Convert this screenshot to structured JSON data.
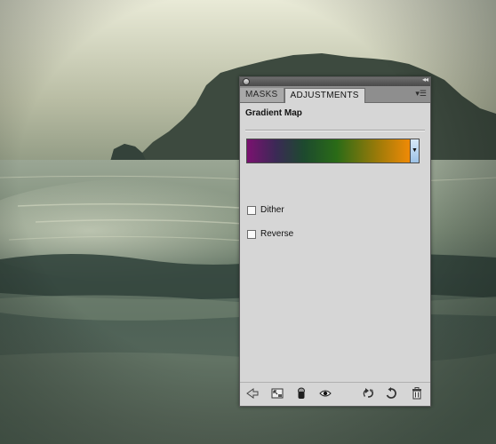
{
  "panel": {
    "tabs": [
      {
        "label": "MASKS",
        "active": false
      },
      {
        "label": "ADJUSTMENTS",
        "active": true
      }
    ],
    "adjustment_title": "Gradient Map",
    "gradient": {
      "stops": [
        "#7b1170",
        "#1d4a2e",
        "#2a6b17",
        "#f08a06"
      ]
    },
    "options": {
      "dither_label": "Dither",
      "reverse_label": "Reverse"
    },
    "bottom_icons": [
      "back-arrow-icon",
      "expanded-view-icon",
      "clip-to-layer-icon",
      "visibility-eye-icon",
      "view-previous-state-icon",
      "reset-icon",
      "trash-icon"
    ]
  },
  "colors": {
    "panel_bg": "#d6d6d6",
    "tab_bar": "#8e8e8e"
  }
}
